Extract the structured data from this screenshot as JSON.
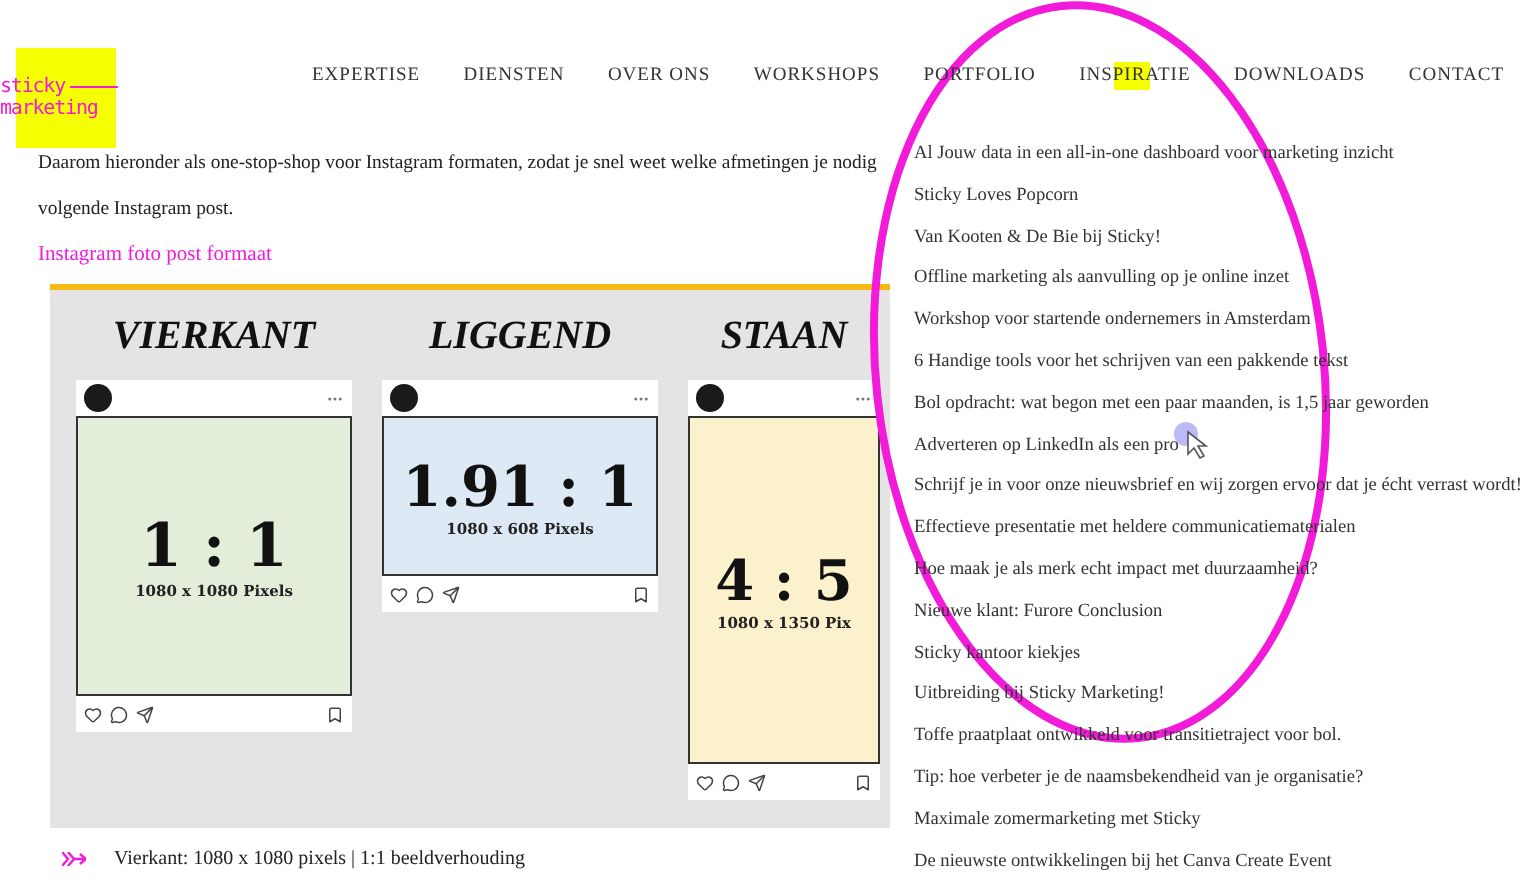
{
  "logo": {
    "lines": [
      "sticky",
      "marketing"
    ]
  },
  "nav": [
    {
      "label": "EXPERTISE",
      "highlighted": false
    },
    {
      "label": "DIENSTEN",
      "highlighted": false
    },
    {
      "label": "OVER ONS",
      "highlighted": false
    },
    {
      "label": "WORKSHOPS",
      "highlighted": false
    },
    {
      "label": "PORTFOLIO",
      "highlighted": false
    },
    {
      "label": "INSPIRATIE",
      "highlighted": true
    },
    {
      "label": "DOWNLOADS",
      "highlighted": false
    },
    {
      "label": "CONTACT",
      "highlighted": false
    }
  ],
  "article": {
    "paragraph_lines": [
      "Daarom hieronder als one-stop-shop voor Instagram formaten, zodat je snel weet welke afmetingen je nodig",
      "volgende Instagram post."
    ],
    "heading": "Instagram foto post formaat",
    "infographic": [
      {
        "kind": "square",
        "title": "VIERKANT",
        "ratio": "1 : 1",
        "pixels": "1080 x 1080 Pixels",
        "color": "#e2eed9"
      },
      {
        "kind": "landscape",
        "title": "LIGGEND",
        "ratio": "1.91 : 1",
        "pixels": "1080 x 608 Pixels",
        "color": "#dde9f5"
      },
      {
        "kind": "portrait",
        "title": "STAAN",
        "ratio": "4 : 5",
        "pixels": "1080 x 1350 Pix",
        "color": "#fcf1cd"
      }
    ],
    "bullets": [
      "Vierkant: 1080 x 1080 pixels | 1:1 beeldverhouding"
    ]
  },
  "dropdown": [
    "Al Jouw data in een all-in-one dashboard voor marketing inzicht",
    "Sticky Loves Popcorn",
    "Van Kooten & De Bie bij Sticky!",
    "Offline marketing als aanvulling op je online inzet",
    "Workshop voor startende ondernemers in Amsterdam",
    "6 Handige tools voor het schrijven van een pakkende tekst",
    "Bol opdracht: wat begon met een paar maanden, is 1,5 jaar geworden",
    "Adverteren op LinkedIn als een pro",
    "Schrijf je in voor onze nieuwsbrief en wij zorgen ervoor dat je écht verrast wordt!",
    "Effectieve presentatie met heldere communicatiematerialen",
    "Hoe maak je als merk echt impact met duurzaamheid?",
    "Nieuwe klant: Furore Conclusion",
    "Sticky kantoor kiekjes",
    "Uitbreiding bij Sticky Marketing!",
    "Toffe praatplaat ontwikkeld voor transitietraject voor bol.",
    "Tip: hoe verbeter je de naamsbekendheid van je organisatie?",
    "Maximale zomermarketing met Sticky",
    "De nieuwste ontwikkelingen bij het Canva Create Event"
  ]
}
